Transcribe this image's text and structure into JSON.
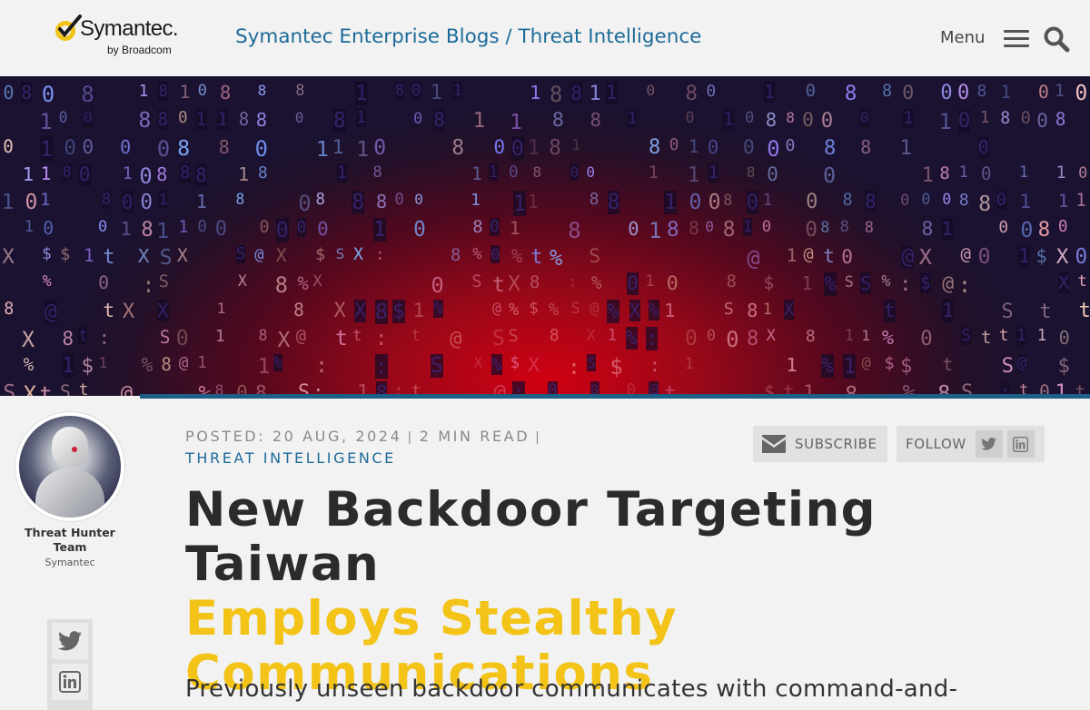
{
  "header": {
    "logo_word": "Symantec.",
    "logo_sub": "by Broadcom",
    "site_title": "Symantec Enterprise Blogs / Threat Intelligence",
    "menu_label": "Menu"
  },
  "hero": {
    "description": "binary code matrix background in red and blue"
  },
  "author": {
    "name": "Threat Hunter Team",
    "org": "Symantec"
  },
  "share": {
    "items": [
      {
        "icon": "twitter-icon"
      },
      {
        "icon": "linkedin-icon"
      }
    ]
  },
  "article": {
    "posted": "POSTED: 20 AUG, 2024",
    "separator": "|",
    "read_time": "2 MIN READ",
    "category": "THREAT INTELLIGENCE",
    "title_line1": "New Backdoor Targeting Taiwan",
    "title_line2": "Employs Stealthy",
    "title_line3": "Communications",
    "summary": "Previously unseen backdoor communicates with command-and-"
  },
  "actions": {
    "subscribe_label": "SUBSCRIBE",
    "follow_label": "FOLLOW"
  },
  "colors": {
    "brand_blue": "#1d6b9a",
    "accent_gold": "#f3c317",
    "card_border": "#1d5f85"
  }
}
